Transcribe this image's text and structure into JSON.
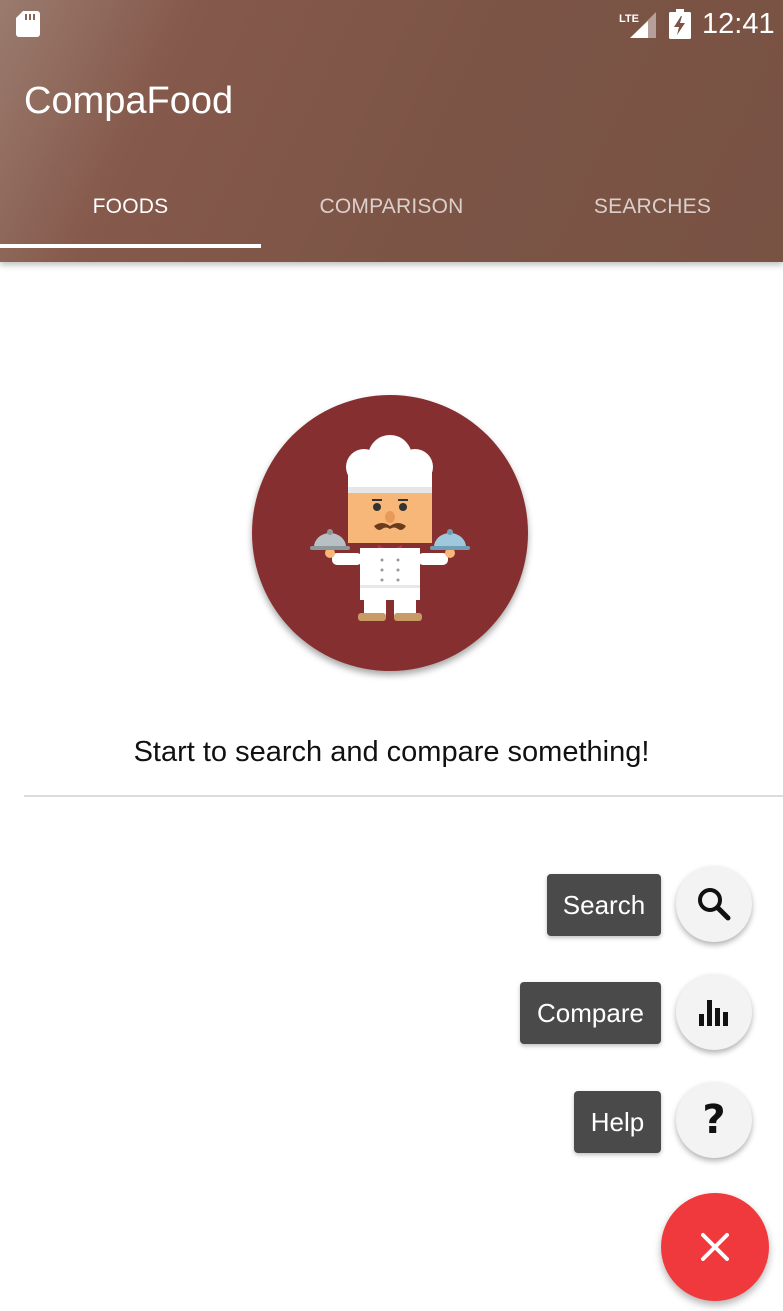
{
  "statusbar": {
    "network": "LTE",
    "time": "12:41"
  },
  "app": {
    "title": "CompaFood"
  },
  "tabs": [
    {
      "label": "FOODS",
      "active": true
    },
    {
      "label": "COMPARISON",
      "active": false
    },
    {
      "label": "SEARCHES",
      "active": false
    }
  ],
  "main": {
    "empty_message": "Start to search and compare something!"
  },
  "speed_dial": {
    "actions": [
      {
        "label": "Search",
        "icon": "search-icon"
      },
      {
        "label": "Compare",
        "icon": "bar-chart-icon"
      },
      {
        "label": "Help",
        "icon": "help-icon",
        "glyph": "?"
      }
    ],
    "main_icon": "close-icon"
  },
  "colors": {
    "app_bar": "#7b5446",
    "hero_circle": "#862f30",
    "fab": "#f0393d",
    "fab_label": "#4a4a4a"
  }
}
